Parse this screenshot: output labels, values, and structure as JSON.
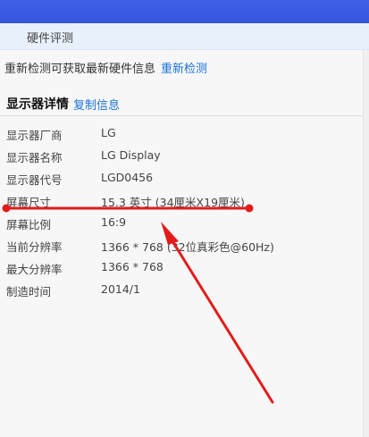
{
  "tab": {
    "label": "硬件评测"
  },
  "notice": {
    "text": "重新检测可获取最新硬件信息",
    "recheck_label": "重新检测"
  },
  "section": {
    "title": "显示器详情",
    "copy_label": "复制信息"
  },
  "details": [
    {
      "label": "显示器厂商",
      "value": "LG"
    },
    {
      "label": "显示器名称",
      "value": "LG Display"
    },
    {
      "label": "显示器代号",
      "value": "LGD0456"
    },
    {
      "label": "屏幕尺寸",
      "value": "15.3 英寸 (34厘米X19厘米)"
    },
    {
      "label": "屏幕比例",
      "value": "16:9"
    },
    {
      "label": "当前分辨率",
      "value": "1366 * 768 (32位真彩色@60Hz)"
    },
    {
      "label": "最大分辨率",
      "value": "1366 * 768"
    },
    {
      "label": "制造时间",
      "value": "2014/1"
    }
  ],
  "colors": {
    "header_blue": "#3554de",
    "link_blue": "#1a73d9",
    "annotation_red": "#e31b1b"
  }
}
